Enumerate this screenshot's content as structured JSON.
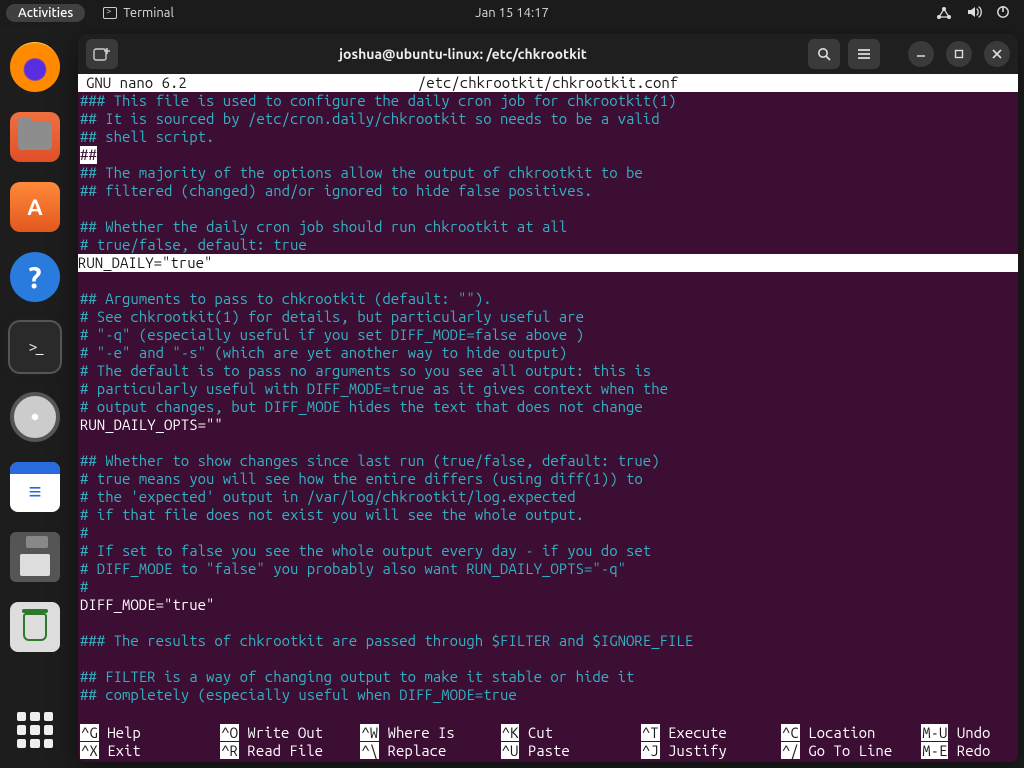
{
  "panel": {
    "activities": "Activities",
    "app_label": "Terminal",
    "clock": "Jan 15  14:17"
  },
  "window": {
    "title": "joshua@ubuntu-linux: /etc/chkrootkit"
  },
  "nano": {
    "version": "  GNU nano 6.2",
    "filepath": "/etc/chkrootkit/chkrootkit.conf"
  },
  "file_lines": [
    {
      "t": "comment",
      "s": "### This file is used to configure the daily cron job for chkrootkit(1)"
    },
    {
      "t": "comment",
      "s": "## It is sourced by /etc/cron.daily/chkrootkit so needs to be a valid"
    },
    {
      "t": "comment",
      "s": "## shell script."
    },
    {
      "t": "invhash",
      "s": "##"
    },
    {
      "t": "comment",
      "s": "## The majority of the options allow the output of chkrootkit to be"
    },
    {
      "t": "comment",
      "s": "## filtered (changed) and/or ignored to hide false positives."
    },
    {
      "t": "blank",
      "s": ""
    },
    {
      "t": "comment",
      "s": "## Whether the daily cron job should run chkrootkit at all"
    },
    {
      "t": "comment",
      "s": "# true/false, default: true"
    },
    {
      "t": "cursor",
      "s": "RUN_DAILY=\"true\""
    },
    {
      "t": "blank",
      "s": ""
    },
    {
      "t": "comment",
      "s": "## Arguments to pass to chkrootkit (default: \"\")."
    },
    {
      "t": "comment",
      "s": "# See chkrootkit(1) for details, but particularly useful are"
    },
    {
      "t": "comment",
      "s": "#  \"-q\" (especially useful if you set DIFF_MODE=false above )"
    },
    {
      "t": "comment",
      "s": "#  \"-e\" and \"-s\" (which are yet another way to hide output)"
    },
    {
      "t": "comment",
      "s": "# The default is to pass no arguments so you see all output: this is"
    },
    {
      "t": "comment",
      "s": "# particularly useful with DIFF_MODE=true as it gives context when the"
    },
    {
      "t": "comment",
      "s": "# output changes, but DIFF_MODE hides the text that does not change"
    },
    {
      "t": "code",
      "s": "RUN_DAILY_OPTS=\"\""
    },
    {
      "t": "blank",
      "s": ""
    },
    {
      "t": "comment",
      "s": "## Whether to show changes since last run (true/false, default: true)"
    },
    {
      "t": "comment",
      "s": "# true means you will see how the entire differs (using diff(1)) to"
    },
    {
      "t": "comment",
      "s": "# the 'expected' output in /var/log/chkrootkit/log.expected"
    },
    {
      "t": "comment",
      "s": "# if that file does not exist you will see the whole output."
    },
    {
      "t": "comment",
      "s": "#"
    },
    {
      "t": "comment",
      "s": "# If set to false you see the whole output every day - if you do set"
    },
    {
      "t": "comment",
      "s": "# DIFF_MODE to \"false\" you probably also want RUN_DAILY_OPTS=\"-q\""
    },
    {
      "t": "comment",
      "s": "#"
    },
    {
      "t": "code",
      "s": "DIFF_MODE=\"true\""
    },
    {
      "t": "blank",
      "s": ""
    },
    {
      "t": "comment",
      "s": "### The results of chkrootkit are passed through $FILTER and $IGNORE_FILE"
    },
    {
      "t": "blank",
      "s": ""
    },
    {
      "t": "comment",
      "s": "## FILTER is a way of changing output to make it stable or hide it"
    },
    {
      "t": "comment",
      "s": "## completely (especially useful when DIFF_MODE=true"
    }
  ],
  "shortcuts": {
    "row1": [
      {
        "k": "^G",
        "l": "Help"
      },
      {
        "k": "^O",
        "l": "Write Out"
      },
      {
        "k": "^W",
        "l": "Where Is"
      },
      {
        "k": "^K",
        "l": "Cut"
      },
      {
        "k": "^T",
        "l": "Execute"
      },
      {
        "k": "^C",
        "l": "Location"
      },
      {
        "k": "M-U",
        "l": "Undo"
      }
    ],
    "row2": [
      {
        "k": "^X",
        "l": "Exit"
      },
      {
        "k": "^R",
        "l": "Read File"
      },
      {
        "k": "^\\",
        "l": "Replace"
      },
      {
        "k": "^U",
        "l": "Paste"
      },
      {
        "k": "^J",
        "l": "Justify"
      },
      {
        "k": "^/",
        "l": "Go To Line"
      },
      {
        "k": "M-E",
        "l": "Redo"
      }
    ]
  }
}
